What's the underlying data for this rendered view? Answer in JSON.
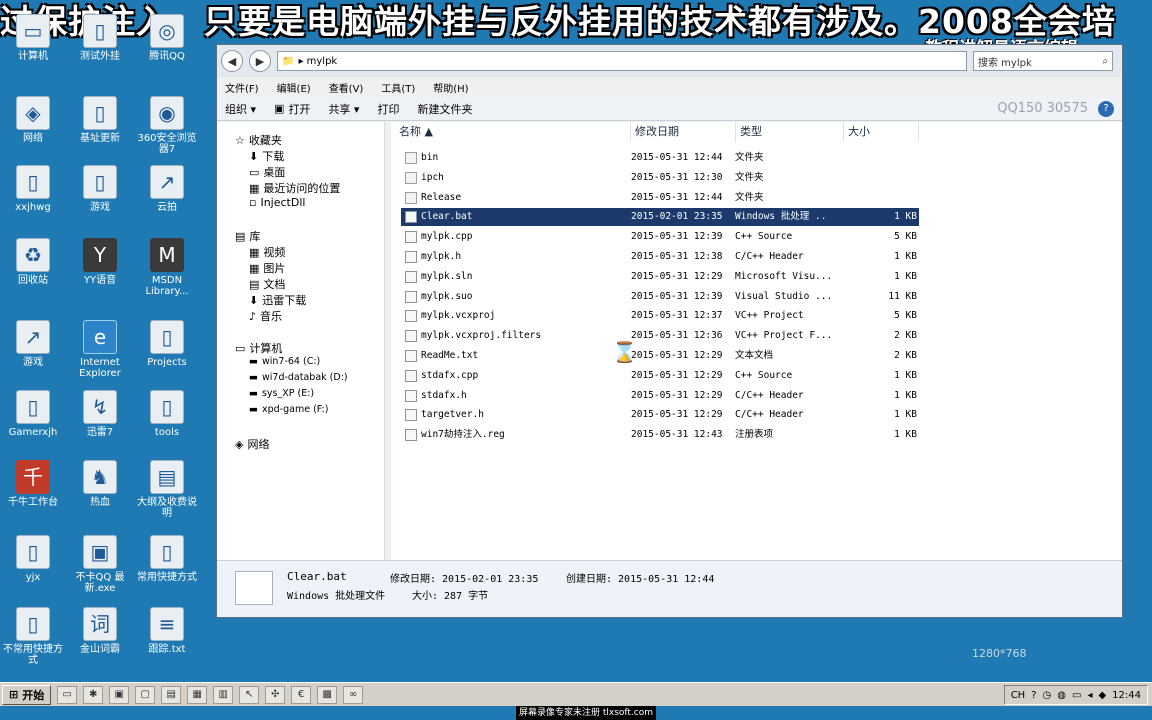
{
  "overlay": {
    "banner": "过保护注入，只要是电脑端外挂与反外挂用的技术都有涉及。2008全会培",
    "watermark": "教程讲解易语言编辑"
  },
  "desktop_icons": [
    {
      "label": "计算机",
      "icon": "computer-icon"
    },
    {
      "label": "测试外挂",
      "icon": "folder-icon"
    },
    {
      "label": "腾讯QQ",
      "icon": "qq-icon"
    },
    {
      "label": "网络",
      "icon": "network-icon"
    },
    {
      "label": "基址更新",
      "icon": "folder-icon"
    },
    {
      "label": "360安全浏览器7",
      "icon": "browser-icon"
    },
    {
      "label": "xxjhwg",
      "icon": "folder-icon"
    },
    {
      "label": "游戏",
      "icon": "folder-icon"
    },
    {
      "label": "云拍",
      "icon": "shortcut-icon"
    },
    {
      "label": "回收站",
      "icon": "recycle-bin-icon"
    },
    {
      "label": "YY语音",
      "icon": "yy-icon"
    },
    {
      "label": "MSDN Library...",
      "icon": "msdn-icon"
    },
    {
      "label": "游戏",
      "icon": "shortcut-icon"
    },
    {
      "label": "Internet Explorer",
      "icon": "ie-icon"
    },
    {
      "label": "Projects",
      "icon": "folder-icon"
    },
    {
      "label": "Gamerxjh",
      "icon": "folder-icon"
    },
    {
      "label": "迅雷7",
      "icon": "thunder-icon"
    },
    {
      "label": "tools",
      "icon": "folder-icon"
    },
    {
      "label": "千牛工作台",
      "icon": "qianniu-icon"
    },
    {
      "label": "热血",
      "icon": "game-icon"
    },
    {
      "label": "大纲及收费说明",
      "icon": "document-icon"
    },
    {
      "label": "yjx",
      "icon": "folder-icon"
    },
    {
      "label": "不卡QQ 最新.exe",
      "icon": "exe-icon"
    },
    {
      "label": "常用快捷方式",
      "icon": "folder-icon"
    },
    {
      "label": "不常用快捷方式",
      "icon": "folder-icon"
    },
    {
      "label": "金山词霸",
      "icon": "ciba-icon"
    },
    {
      "label": "跟踪.txt",
      "icon": "text-file-icon"
    }
  ],
  "window": {
    "address": "▸ mylpk",
    "search_placeholder": "搜索 mylpk",
    "menu": [
      "文件(F)",
      "编辑(E)",
      "查看(V)",
      "工具(T)",
      "帮助(H)"
    ],
    "toolbar": [
      "组织 ▾",
      "打开",
      "共享 ▾",
      "打印",
      "新建文件夹"
    ],
    "toolbar_qq": "QQ150 30575",
    "nav": {
      "favorites": "收藏夹",
      "favorites_items": [
        "下载",
        "桌面",
        "最近访问的位置",
        "InjectDll"
      ],
      "library": "库",
      "library_items": [
        "视频",
        "图片",
        "文档",
        "迅雷下载",
        "音乐"
      ],
      "computer": "计算机",
      "drives": [
        "win7-64 (C:)",
        "wi7d-databak (D:)",
        "sys_XP (E:)",
        "xpd-game (F:)"
      ],
      "network": "网络"
    },
    "columns": [
      "名称",
      "修改日期",
      "类型",
      "大小"
    ],
    "files": [
      {
        "name": "bin",
        "date": "2015-05-31 12:44",
        "type": "文件夹",
        "size": "",
        "folder": true
      },
      {
        "name": "ipch",
        "date": "2015-05-31 12:30",
        "type": "文件夹",
        "size": "",
        "folder": true
      },
      {
        "name": "Release",
        "date": "2015-05-31 12:44",
        "type": "文件夹",
        "size": "",
        "folder": true
      },
      {
        "name": "Clear.bat",
        "date": "2015-02-01 23:35",
        "type": "Windows 批处理 ..",
        "size": "1 KB",
        "selected": true
      },
      {
        "name": "mylpk.cpp",
        "date": "2015-05-31 12:39",
        "type": "C++ Source",
        "size": "5 KB"
      },
      {
        "name": "mylpk.h",
        "date": "2015-05-31 12:38",
        "type": "C/C++ Header",
        "size": "1 KB"
      },
      {
        "name": "mylpk.sln",
        "date": "2015-05-31 12:29",
        "type": "Microsoft Visu...",
        "size": "1 KB"
      },
      {
        "name": "mylpk.suo",
        "date": "2015-05-31 12:39",
        "type": "Visual Studio ...",
        "size": "11 KB"
      },
      {
        "name": "mylpk.vcxproj",
        "date": "2015-05-31 12:37",
        "type": "VC++ Project",
        "size": "5 KB"
      },
      {
        "name": "mylpk.vcxproj.filters",
        "date": "2015-05-31 12:36",
        "type": "VC++ Project F...",
        "size": "2 KB"
      },
      {
        "name": "ReadMe.txt",
        "date": "2015-05-31 12:29",
        "type": "文本文档",
        "size": "2 KB"
      },
      {
        "name": "stdafx.cpp",
        "date": "2015-05-31 12:29",
        "type": "C++ Source",
        "size": "1 KB"
      },
      {
        "name": "stdafx.h",
        "date": "2015-05-31 12:29",
        "type": "C/C++ Header",
        "size": "1 KB"
      },
      {
        "name": "targetver.h",
        "date": "2015-05-31 12:29",
        "type": "C/C++ Header",
        "size": "1 KB"
      },
      {
        "name": "win7劫持注入.reg",
        "date": "2015-05-31 12:43",
        "type": "注册表项",
        "size": "1 KB"
      }
    ],
    "details": {
      "name": "Clear.bat",
      "type": "Windows 批处理文件",
      "modified_label": "修改日期: 2015-02-01 23:35",
      "created_label": "创建日期: 2015-05-31 12:44",
      "size_label": "大小: 287 字节"
    }
  },
  "resolution_tag": "1280*768",
  "taskbar": {
    "start": "开始",
    "tray_lang": "CH",
    "clock": "12:44"
  },
  "registration_note": "屏幕录像专家未注册 tlxsoft.com"
}
